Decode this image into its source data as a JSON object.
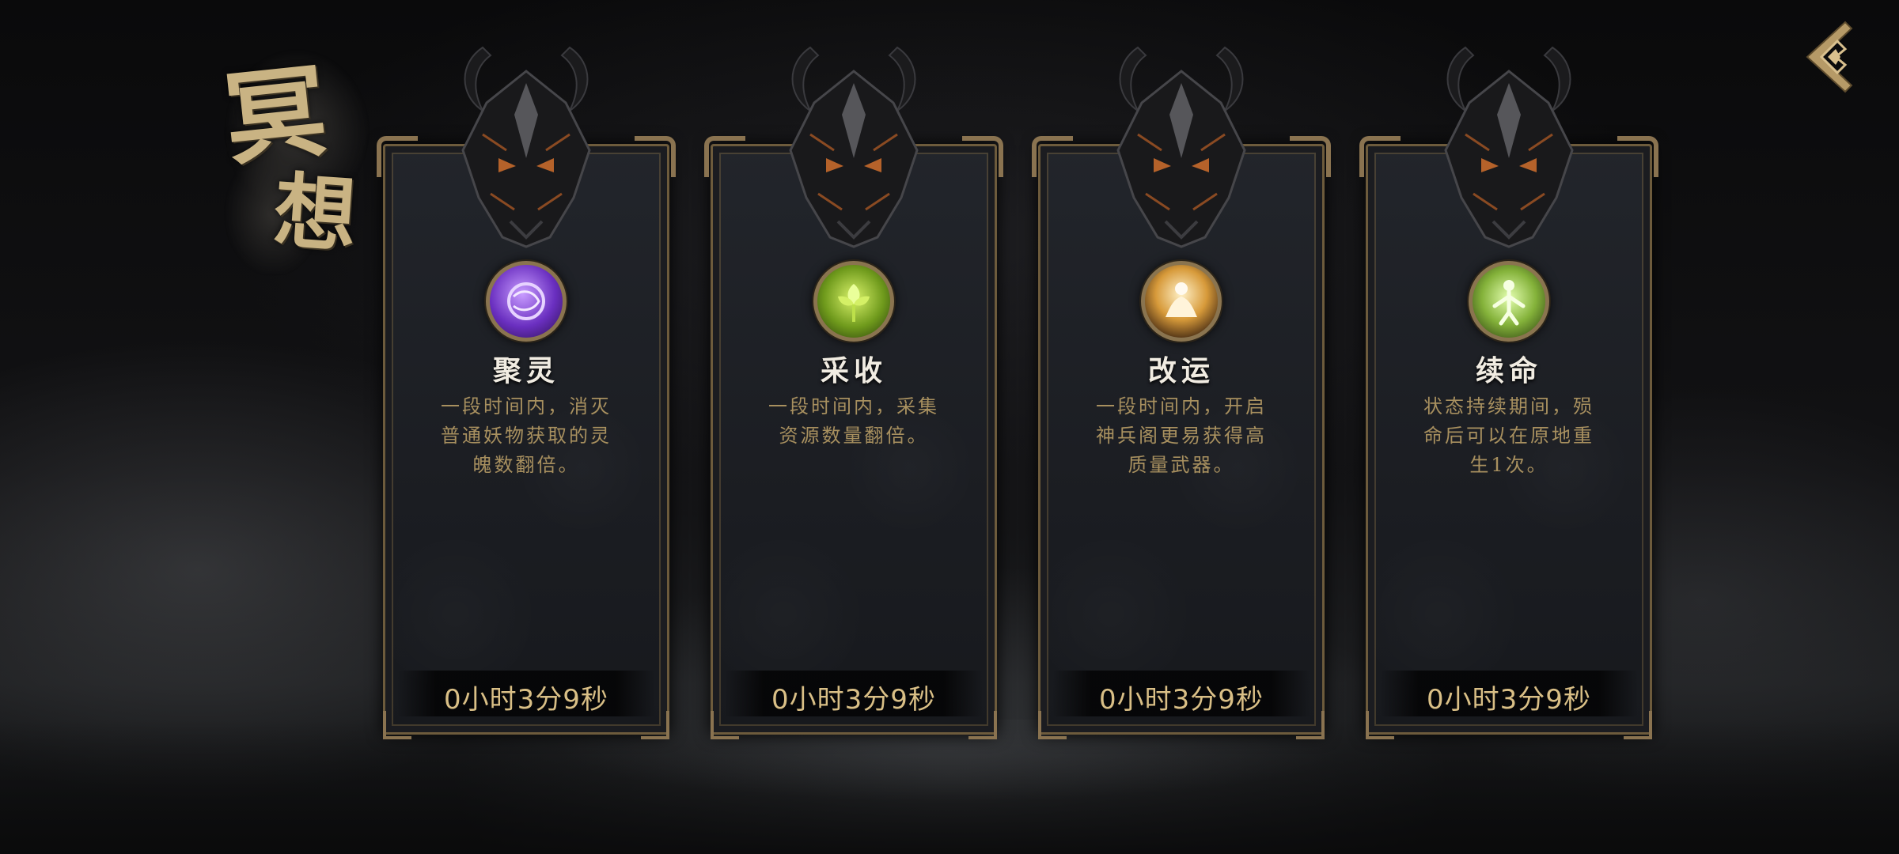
{
  "page_title": {
    "char1": "冥",
    "char2": "想"
  },
  "back_button": {
    "icon": "back-arrow-icon"
  },
  "colors": {
    "gold_text": "#d9bf86",
    "desc_text": "#a8905f",
    "name_text": "#f1ece2",
    "frame": "#8a7350"
  },
  "cards": [
    {
      "name": "聚灵",
      "icon": "spirit-orb-icon",
      "icon_color": "#7a3fd6",
      "desc_lines": [
        "一段时间内，消灭",
        "普通妖物获取的灵",
        "魄数翻倍。"
      ],
      "timer": "0小时3分9秒"
    },
    {
      "name": "采收",
      "icon": "herb-flower-icon",
      "icon_color": "#8fc22e",
      "desc_lines": [
        "一段时间内，采集",
        "资源数量翻倍。"
      ],
      "timer": "0小时3分9秒"
    },
    {
      "name": "改运",
      "icon": "meditating-figure-icon",
      "icon_color": "#e3b04b",
      "desc_lines": [
        "一段时间内，开启",
        "神兵阁更易获得高",
        "质量武器。"
      ],
      "timer": "0小时3分9秒"
    },
    {
      "name": "续命",
      "icon": "revive-figure-icon",
      "icon_color": "#9bc44a",
      "desc_lines": [
        "状态持续期间，殒",
        "命后可以在原地重",
        "生1次。"
      ],
      "timer": "0小时3分9秒"
    }
  ]
}
